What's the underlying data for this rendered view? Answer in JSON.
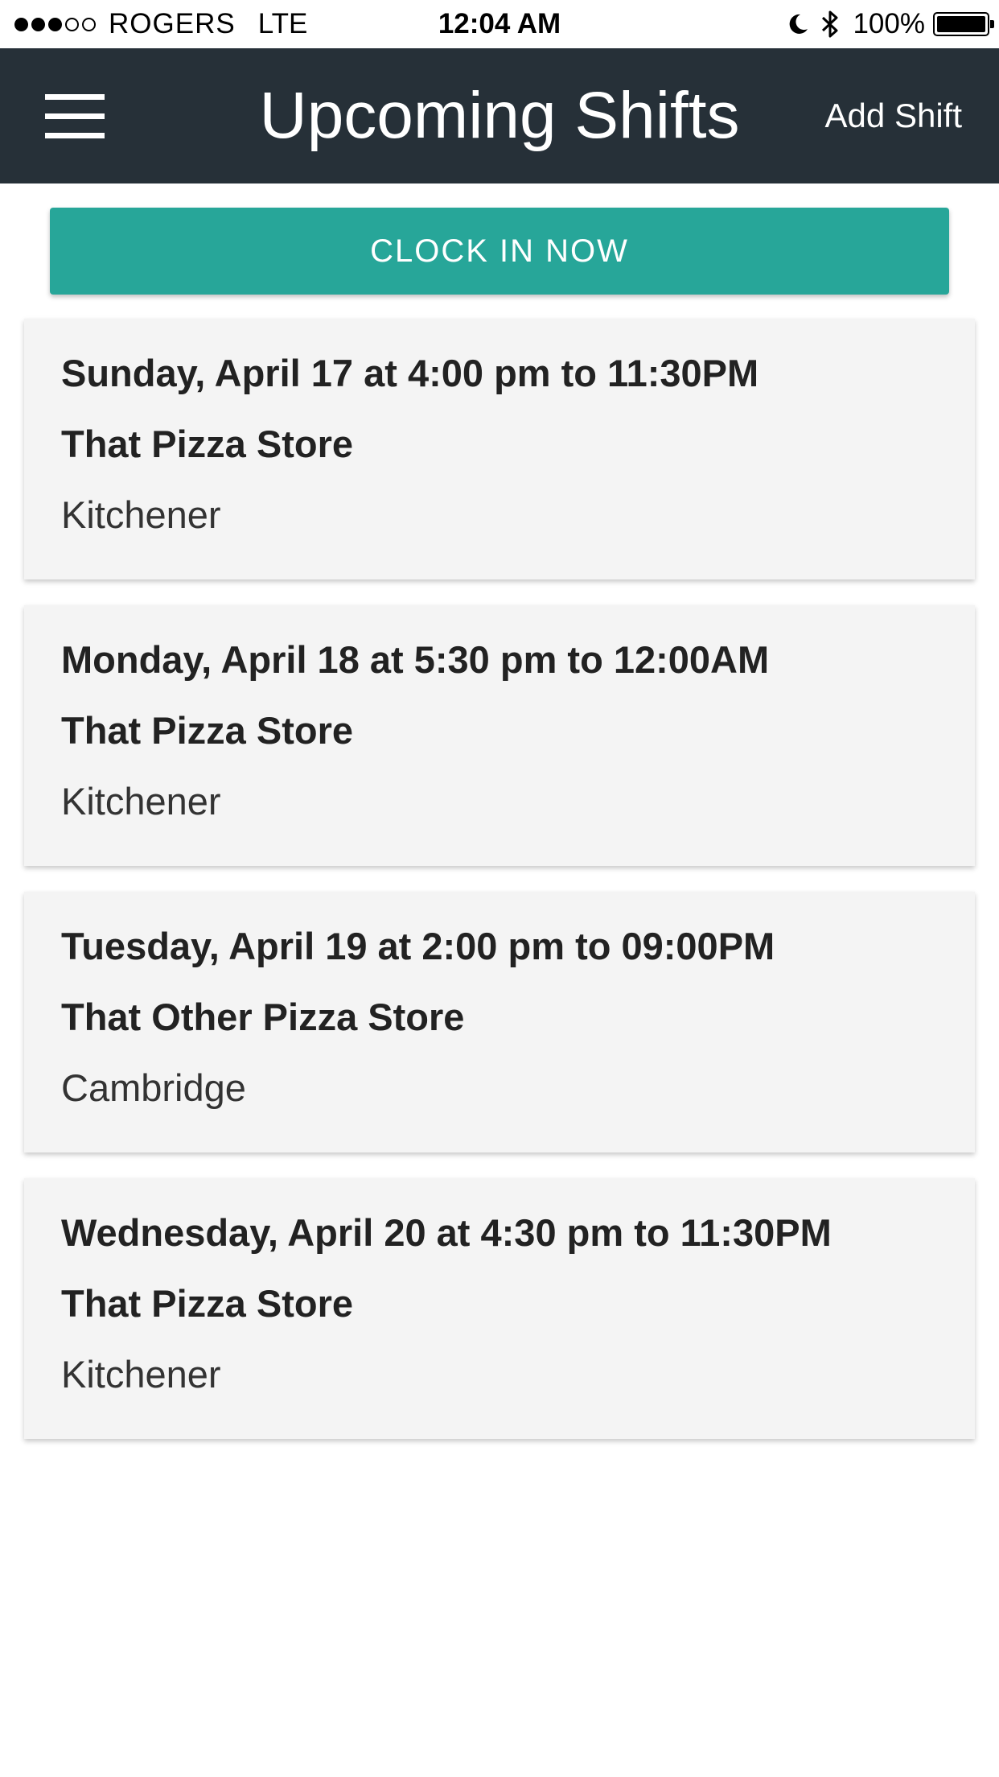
{
  "status_bar": {
    "carrier": "ROGERS",
    "network": "LTE",
    "time": "12:04 AM",
    "battery": "100%",
    "signal_bars_filled": 3,
    "signal_bars_total": 5
  },
  "header": {
    "title": "Upcoming Shifts",
    "add_shift_label": "Add Shift",
    "background_color": "#263038"
  },
  "clock_in": {
    "label": "CLOCK IN NOW",
    "color": "#27a699"
  },
  "shifts": [
    {
      "datetime": "Sunday, April 17 at 4:00 pm to 11:30PM",
      "store": "That Pizza Store",
      "city": "Kitchener"
    },
    {
      "datetime": "Monday, April 18 at 5:30 pm to 12:00AM",
      "store": "That Pizza Store",
      "city": "Kitchener"
    },
    {
      "datetime": "Tuesday, April 19 at 2:00 pm to 09:00PM",
      "store": "That Other Pizza Store",
      "city": "Cambridge"
    },
    {
      "datetime": "Wednesday, April 20 at 4:30 pm to 11:30PM",
      "store": "That Pizza Store",
      "city": "Kitchener"
    }
  ],
  "icons": {
    "menu": "hamburger-menu-icon",
    "moon": "do-not-disturb-moon-icon",
    "bluetooth": "bluetooth-icon",
    "battery": "battery-icon"
  }
}
